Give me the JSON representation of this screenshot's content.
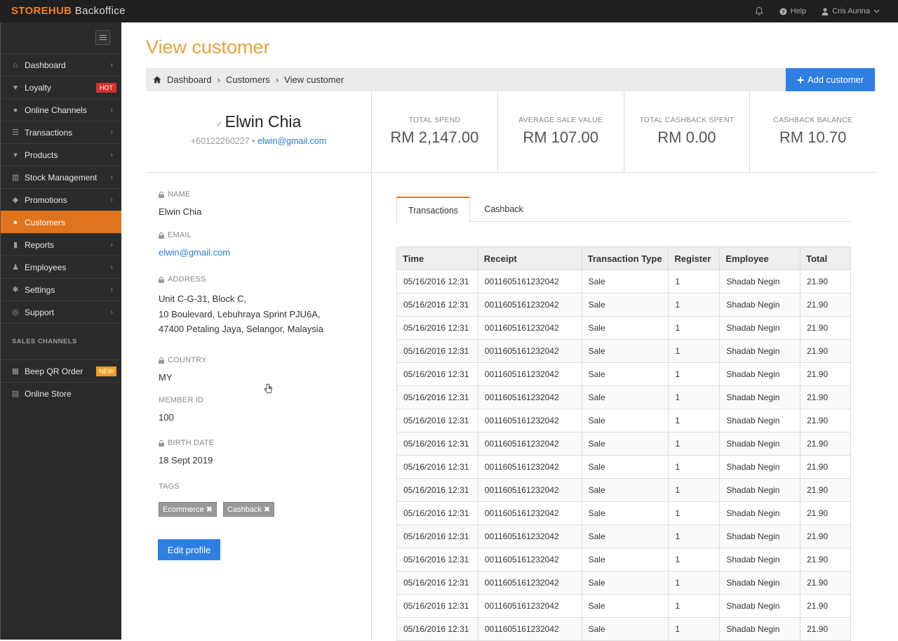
{
  "topbar": {
    "brand_part1": "STOREHUB",
    "brand_part2": " Backoffice",
    "help": "Help",
    "user": "Cris Aurina"
  },
  "sidebar": {
    "items": [
      {
        "label": "Dashboard",
        "icon": "dashboard-icon"
      },
      {
        "label": "Loyalty",
        "icon": "heart-icon",
        "badge": "HOT"
      },
      {
        "label": "Online Channels",
        "icon": "globe-icon"
      },
      {
        "label": "Transactions",
        "icon": "list-icon"
      },
      {
        "label": "Products",
        "icon": "cart-icon"
      },
      {
        "label": "Stock Management",
        "icon": "barcode-icon"
      },
      {
        "label": "Promotions",
        "icon": "tags-icon"
      },
      {
        "label": "Customers",
        "icon": "users-icon",
        "active": true
      },
      {
        "label": "Reports",
        "icon": "bar-chart-icon"
      },
      {
        "label": "Employees",
        "icon": "person-icon"
      },
      {
        "label": "Settings",
        "icon": "gears-icon"
      },
      {
        "label": "Support",
        "icon": "lifebuoy-icon"
      }
    ],
    "sales_channels_label": "SALES CHANNELS",
    "channels": [
      {
        "label": "Beep QR Order",
        "icon": "qr-icon",
        "badge": "NEW"
      },
      {
        "label": "Online Store",
        "icon": "basket-icon"
      }
    ]
  },
  "page": {
    "title": "View customer",
    "breadcrumb": [
      "Dashboard",
      "Customers",
      "View customer"
    ],
    "add_button": "Add customer"
  },
  "customer": {
    "name": "Elwin Chia",
    "phone": "+60122260227",
    "email": "elwin@gmail.com"
  },
  "stats": [
    {
      "label": "TOTAL SPEND",
      "value": "RM 2,147.00"
    },
    {
      "label": "AVERAGE SALE VALUE",
      "value": "RM 107.00"
    },
    {
      "label": "TOTAL CASHBACK SPENT",
      "value": "RM 0.00"
    },
    {
      "label": "CASHBACK BALANCE",
      "value": "RM 10.70"
    }
  ],
  "details": {
    "name_label": "NAME",
    "name_value": "Elwin Chia",
    "email_label": "EMAIL",
    "email_value": "elwin@gmail.com",
    "address_label": "ADDRESS",
    "address_line1": "Unit C-G-31, Block C,",
    "address_line2": "10 Boulevard, Lebuhraya Sprint PJU6A,",
    "address_line3": "47400 Petaling Jaya, Selangor, Malaysia",
    "country_label": "COUNTRY",
    "country_value": "MY",
    "member_id_label": "MEMBER ID",
    "member_id_value": "100",
    "birth_date_label": "BIRTH DATE",
    "birth_date_value": "18 Sept 2019",
    "tags_label": "TAGS",
    "tags": [
      "Ecommerce",
      "Cashback"
    ],
    "edit_button": "Edit profile"
  },
  "tabs": [
    "Transactions",
    "Cashback"
  ],
  "table": {
    "headers": [
      "Time",
      "Receipt",
      "Transaction Type",
      "Register",
      "Employee",
      "Total"
    ],
    "rows": [
      [
        "05/16/2016 12:31",
        "0011605161232042",
        "Sale",
        "1",
        "Shadab Negin",
        "21.90"
      ],
      [
        "05/16/2016 12:31",
        "0011605161232042",
        "Sale",
        "1",
        "Shadab Negin",
        "21.90"
      ],
      [
        "05/16/2016 12:31",
        "0011605161232042",
        "Sale",
        "1",
        "Shadab Negin",
        "21.90"
      ],
      [
        "05/16/2016 12:31",
        "0011605161232042",
        "Sale",
        "1",
        "Shadab Negin",
        "21.90"
      ],
      [
        "05/16/2016 12:31",
        "0011605161232042",
        "Sale",
        "1",
        "Shadab Negin",
        "21.90"
      ],
      [
        "05/16/2016 12:31",
        "0011605161232042",
        "Sale",
        "1",
        "Shadab Negin",
        "21.90"
      ],
      [
        "05/16/2016 12:31",
        "0011605161232042",
        "Sale",
        "1",
        "Shadab Negin",
        "21.90"
      ],
      [
        "05/16/2016 12:31",
        "0011605161232042",
        "Sale",
        "1",
        "Shadab Negin",
        "21.90"
      ],
      [
        "05/16/2016 12:31",
        "0011605161232042",
        "Sale",
        "1",
        "Shadab Negin",
        "21.90"
      ],
      [
        "05/16/2016 12:31",
        "0011605161232042",
        "Sale",
        "1",
        "Shadab Negin",
        "21.90"
      ],
      [
        "05/16/2016 12:31",
        "0011605161232042",
        "Sale",
        "1",
        "Shadab Negin",
        "21.90"
      ],
      [
        "05/16/2016 12:31",
        "0011605161232042",
        "Sale",
        "1",
        "Shadab Negin",
        "21.90"
      ],
      [
        "05/16/2016 12:31",
        "0011605161232042",
        "Sale",
        "1",
        "Shadab Negin",
        "21.90"
      ],
      [
        "05/16/2016 12:31",
        "0011605161232042",
        "Sale",
        "1",
        "Shadab Negin",
        "21.90"
      ],
      [
        "05/16/2016 12:31",
        "0011605161232042",
        "Sale",
        "1",
        "Shadab Negin",
        "21.90"
      ],
      [
        "05/16/2016 12:31",
        "0011605161232042",
        "Sale",
        "1",
        "Shadab Negin",
        "21.90"
      ]
    ]
  },
  "colors": {
    "accent_orange": "#e0731e",
    "title_orange": "#e6a23a",
    "primary_blue": "#2f7fe3",
    "link_blue": "#2a7bd4",
    "sidebar_bg": "#2b2b2b"
  }
}
